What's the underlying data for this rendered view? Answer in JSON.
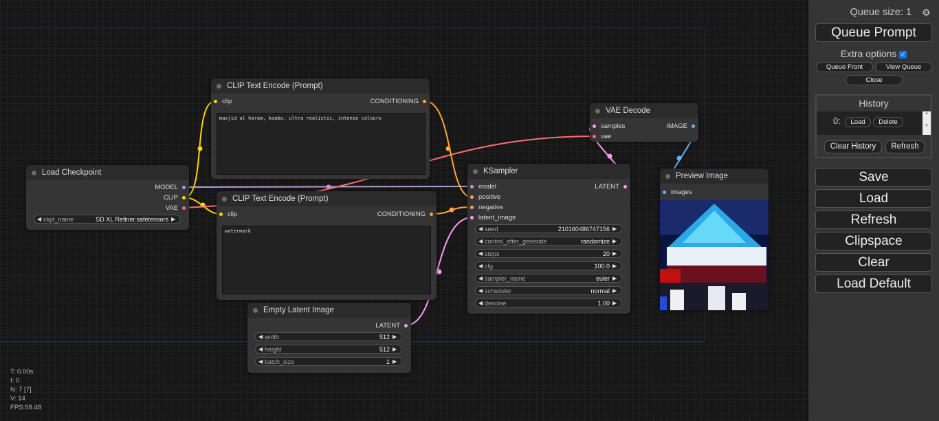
{
  "nodes": {
    "load_checkpoint": {
      "title": "Load Checkpoint",
      "outputs": [
        "MODEL",
        "CLIP",
        "VAE"
      ],
      "widget": {
        "label": "ckpt_name",
        "value": "SD XL Refiner.safetensors"
      }
    },
    "clip_pos": {
      "title": "CLIP Text Encode (Prompt)",
      "input": "clip",
      "output": "CONDITIONING",
      "text": "masjid al haram, kaaba, ultra realistic, intense colours"
    },
    "clip_neg": {
      "title": "CLIP Text Encode (Prompt)",
      "input": "clip",
      "output": "CONDITIONING",
      "text": "watermark"
    },
    "empty_latent": {
      "title": "Empty Latent Image",
      "output": "LATENT",
      "widgets": [
        {
          "label": "width",
          "value": "512"
        },
        {
          "label": "height",
          "value": "512"
        },
        {
          "label": "batch_size",
          "value": "1"
        }
      ]
    },
    "ksampler": {
      "title": "KSampler",
      "inputs": [
        "model",
        "positive",
        "negative",
        "latent_image"
      ],
      "output": "LATENT",
      "widgets": [
        {
          "label": "seed",
          "value": "210160486747156"
        },
        {
          "label": "control_after_generate",
          "value": "randomize"
        },
        {
          "label": "steps",
          "value": "20"
        },
        {
          "label": "cfg",
          "value": "100.0"
        },
        {
          "label": "sampler_name",
          "value": "euler"
        },
        {
          "label": "scheduler",
          "value": "normal"
        },
        {
          "label": "denoise",
          "value": "1.00"
        }
      ]
    },
    "vae_decode": {
      "title": "VAE Decode",
      "inputs": [
        "samples",
        "vae"
      ],
      "output": "IMAGE"
    },
    "preview": {
      "title": "Preview Image",
      "input": "images"
    }
  },
  "stats": {
    "t": "T: 0.00s",
    "i": "I: 0",
    "n": "N: 7 [7]",
    "v": "V: 14",
    "fps": "FPS:58.48"
  },
  "panel": {
    "queue_size": "Queue size: 1",
    "queue_prompt": "Queue Prompt",
    "extra_options": "Extra options",
    "queue_front": "Queue Front",
    "view_queue": "View Queue",
    "close": "Close",
    "history_title": "History",
    "history_item_index": "0:",
    "history_load": "Load",
    "history_delete": "Delete",
    "clear_history": "Clear History",
    "refresh_small": "Refresh",
    "buttons": [
      "Save",
      "Load",
      "Refresh",
      "Clipspace",
      "Clear",
      "Load Default"
    ]
  },
  "colors": {
    "model": "#b39ddb",
    "clip": "#ffd500",
    "vae": "#ff6e6e",
    "conditioning": "#ffa931",
    "latent": "#ff9cf9",
    "image": "#64b5f6"
  }
}
